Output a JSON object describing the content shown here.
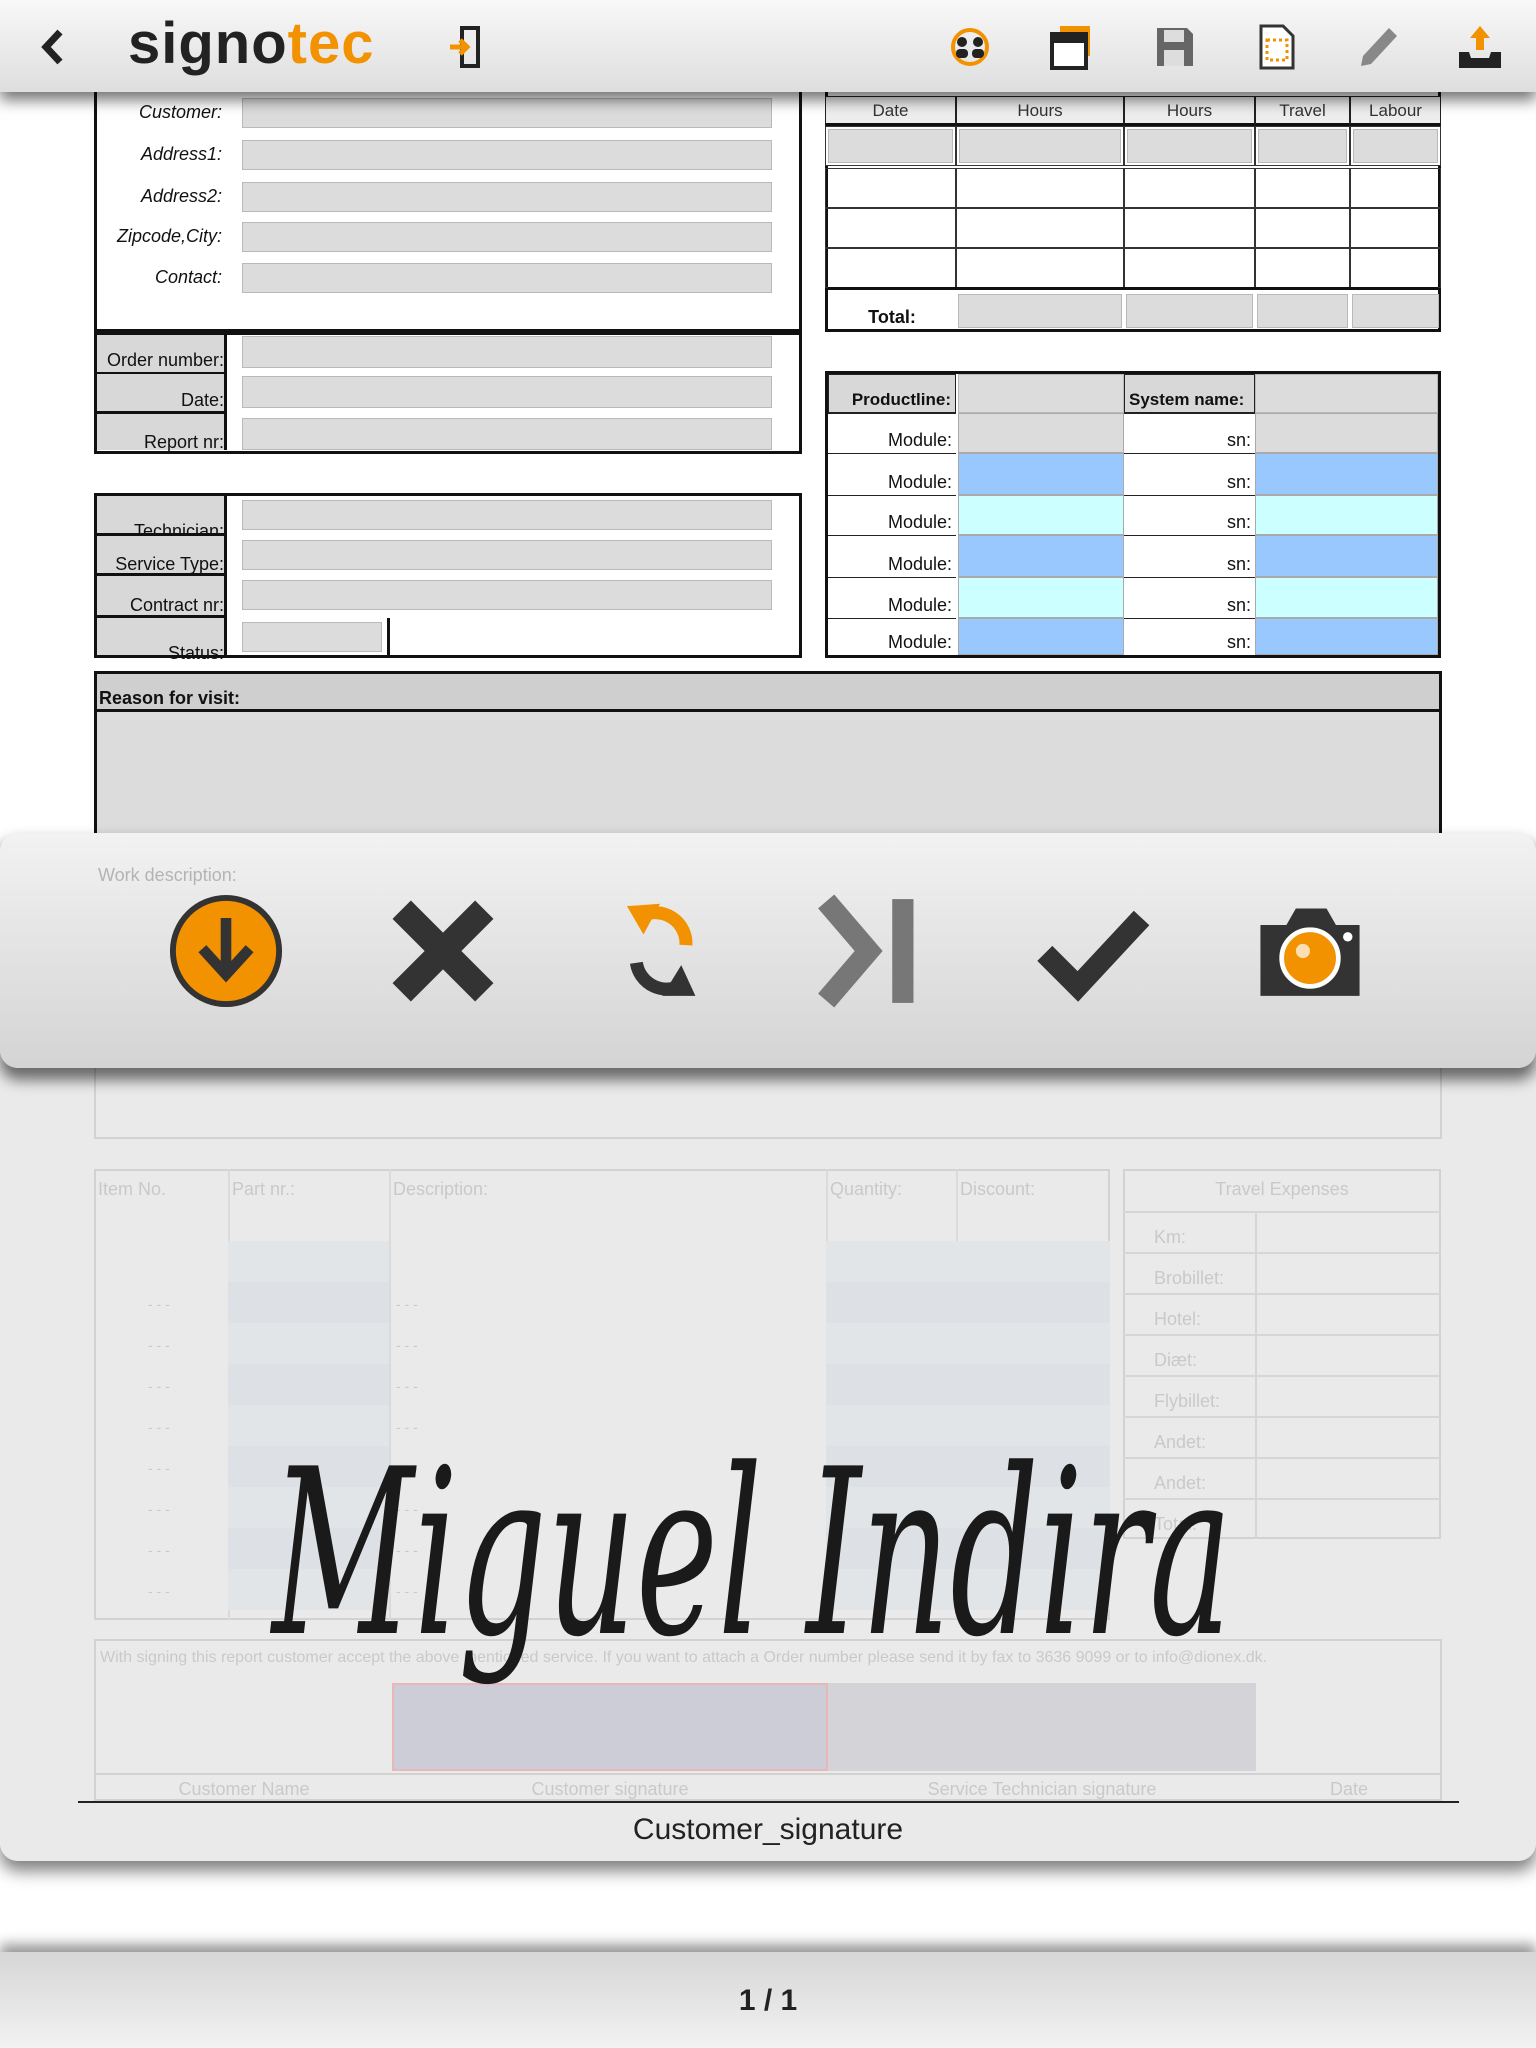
{
  "topbar": {
    "logo_dark": "signo",
    "logo_accent": "tec",
    "accent": "#f39200",
    "icons": [
      "back-icon",
      "exit-icon",
      "users-icon",
      "windows-icon",
      "save-icon",
      "document-select-icon",
      "pen-icon",
      "upload-icon"
    ]
  },
  "customer": {
    "labels": [
      "Customer:",
      "Address1:",
      "Address2:",
      "Zipcode,City:",
      "Contact:"
    ]
  },
  "order": {
    "labels": [
      "Order number:",
      "Date:",
      "Report nr:"
    ]
  },
  "tech": {
    "labels": [
      "Technician:",
      "Service Type:",
      "Contract nr:",
      "Status:"
    ]
  },
  "hours": {
    "headers": [
      "Date",
      "Hours",
      "Hours",
      "Travel",
      "Labour"
    ],
    "total_label": "Total:"
  },
  "product": {
    "productline_label": "Productline:",
    "system_label": "System name:",
    "module_label": "Module:",
    "sn_label": "sn:",
    "row_colors": [
      "#dcdcdc",
      "#99c8ff",
      "#ccffff",
      "#99c8ff",
      "#ccffff",
      "#99c8ff"
    ]
  },
  "reason": {
    "label": "Reason for visit:"
  },
  "work": {
    "label": "Work description:"
  },
  "items": {
    "headers": [
      "Item No.",
      "Part nr.:",
      "Description:",
      "Quantity:",
      "Discount:"
    ],
    "placeholder": "- - -"
  },
  "travel": {
    "title": "Travel Expenses",
    "rows": [
      "Km:",
      "Brobillet:",
      "Hotel:",
      "Diæt:",
      "Flybillet:",
      "Andet:",
      "Andet:",
      "Total:"
    ]
  },
  "footer_form": {
    "notice": "With signing this report customer accept the above mentioned service. If you want to attach a Order number please send it by fax to 3636 9099 or to info@dionex.dk.",
    "columns": [
      "Customer Name",
      "Customer signature",
      "Service Technician signature",
      "Date"
    ]
  },
  "signature_dialog": {
    "tools": [
      "download-icon",
      "close-icon",
      "rotate-icon",
      "skip-icon",
      "check-icon",
      "camera-icon"
    ],
    "signature_name": "Miguel Indira",
    "field_name": "Customer_signature"
  },
  "pager": {
    "text": "1 / 1"
  }
}
